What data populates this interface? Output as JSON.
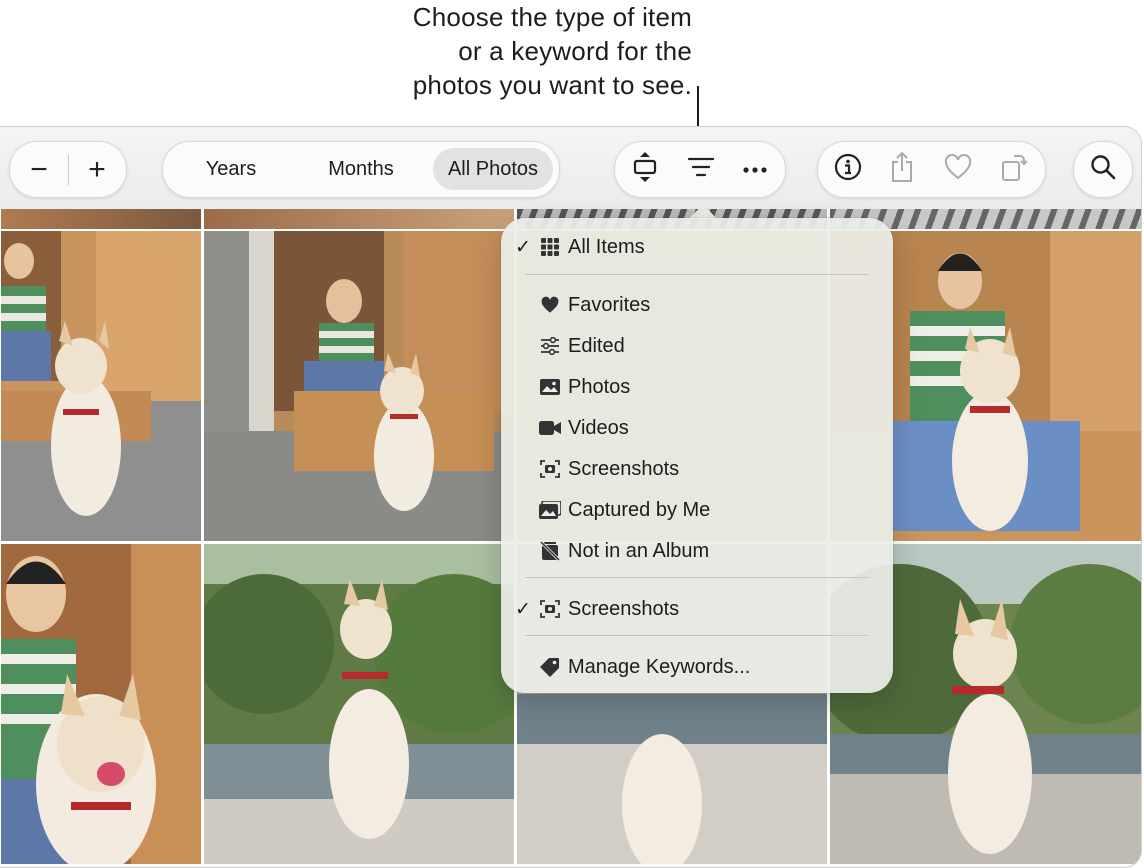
{
  "callout": {
    "line1": "Choose the type of item",
    "line2": "or a keyword for the",
    "line3": "photos you want to see."
  },
  "toolbar": {
    "zoom_out_label": "−",
    "zoom_in_label": "+",
    "segments": [
      {
        "label": "Years",
        "active": false
      },
      {
        "label": "Months",
        "active": false
      },
      {
        "label": "All Photos",
        "active": true
      }
    ],
    "icons": [
      "aspect-icon",
      "filter-icon",
      "more-icon",
      "info-icon",
      "share-icon",
      "heart-icon",
      "rotate-icon",
      "search-icon"
    ]
  },
  "menu": {
    "items": [
      {
        "label": "All Items",
        "checked": true,
        "icon": "grid-icon"
      },
      {
        "label": "Favorites",
        "checked": false,
        "icon": "heart-icon"
      },
      {
        "label": "Edited",
        "checked": false,
        "icon": "sliders-icon"
      },
      {
        "label": "Photos",
        "checked": false,
        "icon": "photo-icon"
      },
      {
        "label": "Videos",
        "checked": false,
        "icon": "video-icon"
      },
      {
        "label": "Screenshots",
        "checked": false,
        "icon": "screenshot-icon"
      },
      {
        "label": "Captured by Me",
        "checked": false,
        "icon": "captured-icon"
      },
      {
        "label": "Not in an Album",
        "checked": false,
        "icon": "not-album-icon"
      },
      {
        "label": "Screenshots",
        "checked": true,
        "icon": "screenshot-icon"
      },
      {
        "label": "Manage Keywords...",
        "checked": false,
        "icon": "tag-icon"
      }
    ],
    "check_glyph": "✓"
  },
  "colors": {
    "toolbar_bg": "#ececec",
    "menu_bg": "#eceee8",
    "text": "#1d1d1f",
    "active_segment": "#e2e2e2"
  }
}
